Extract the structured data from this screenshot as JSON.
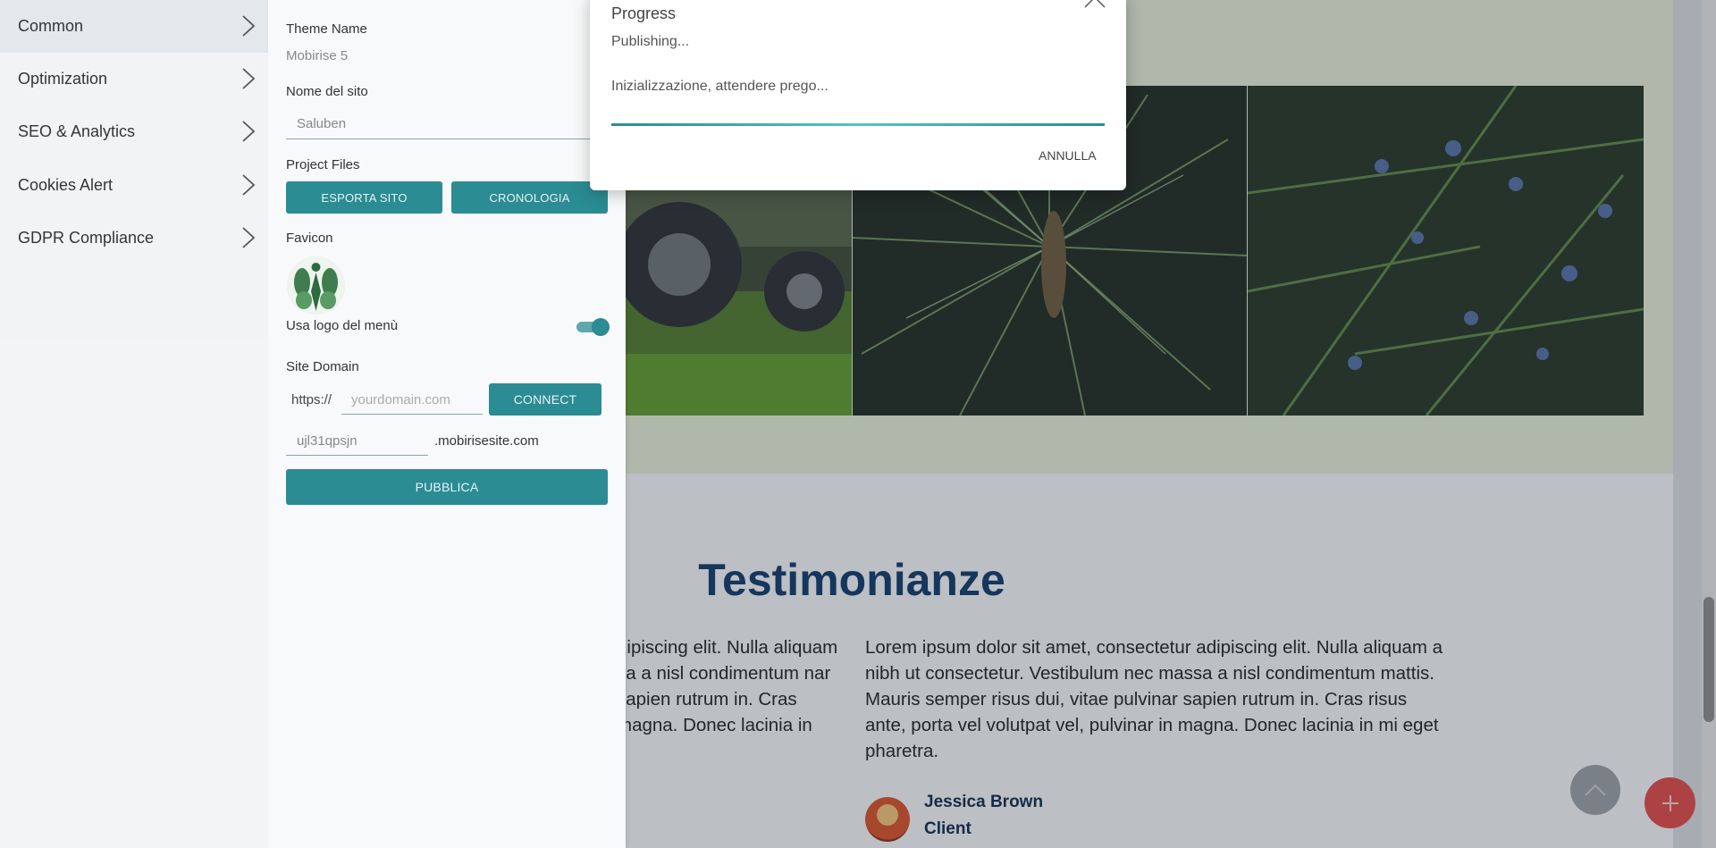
{
  "sidebar": {
    "items": [
      {
        "label": "Common"
      },
      {
        "label": "Optimization"
      },
      {
        "label": "SEO & Analytics"
      },
      {
        "label": "Cookies Alert"
      },
      {
        "label": "GDPR Compliance"
      }
    ]
  },
  "panel": {
    "theme_name_label": "Theme Name",
    "theme_name_value": "Mobirise 5",
    "site_name_label": "Nome del sito",
    "site_name_value": "Saluben",
    "project_files_label": "Project Files",
    "export_button": "ESPORTA SITO",
    "history_button": "CRONOLOGIA",
    "favicon_label": "Favicon",
    "use_menu_logo_label": "Usa logo del menù",
    "use_menu_logo_on": true,
    "site_domain_label": "Site Domain",
    "domain_prefix": "https://",
    "domain_placeholder": "yourdomain.com",
    "connect_button": "CONNECT",
    "subdomain_value": "ujl31qpsjn",
    "subdomain_suffix": ".mobirisesite.com",
    "publish_button": "PUBBLICA"
  },
  "dialog": {
    "title": "Progress",
    "status": "Publishing...",
    "message": "Inizializzazione, attendere prego...",
    "progress": 1.0,
    "cancel_label": "ANNULLA"
  },
  "page": {
    "section_title": "Testimonianze",
    "left_text": "dipiscing elit. Nulla aliquam sa a nisl condimentum nar sapien rutrum in. Cras magna. Donec lacinia in",
    "right_text": "Lorem ipsum dolor sit amet, consectetur adipiscing elit. Nulla aliquam a nibh ut consectetur. Vestibulum nec massa a nisl condimentum mattis. Mauris semper risus dui, vitae pulvinar sapien rutrum in. Cras risus ante, porta vel volutpat vel, pulvinar in magna. Donec lacinia in mi eget pharetra.",
    "person_name": "Jessica Brown",
    "person_role": "Client"
  },
  "icons": {
    "chevron": "chevron-right-icon",
    "close": "close-icon",
    "scroll_up": "chevron-up-icon",
    "add": "plus-icon"
  },
  "colors": {
    "accent": "#2b8c93",
    "title_blue": "#0e3a6b",
    "fab_red": "#e14a4a"
  }
}
